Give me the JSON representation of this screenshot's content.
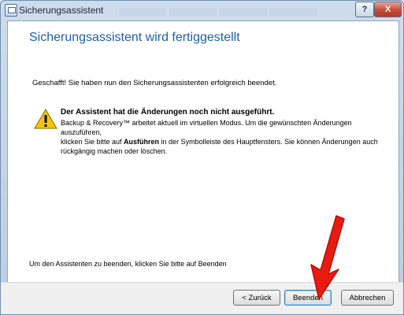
{
  "window": {
    "title": "Sicherungsassistent"
  },
  "wizard": {
    "page_title": "Sicherungsassistent wird fertiggestellt",
    "success_text": "Geschafft! Sie haben nun den Sicherungsassistenten erfolgreich beendet.",
    "warning_title": "Der Assistent hat die Änderungen noch nicht ausgeführt.",
    "warning_line1": "Backup & Recovery™ arbeitet aktuell im virtuellen Modus. Um die gewünschten Änderungen auszuführen,",
    "warning_line2_a": "klicken Sie bitte auf ",
    "warning_line2_bold": "Ausführen",
    "warning_line2_b": " in der Symbolleiste des Hauptfensters. Sie können Änderungen auch",
    "warning_line3": "rückgängig machen oder löschen.",
    "footer_text": "Um den Assistenten zu beenden, klicken Sie bitte auf Beenden"
  },
  "buttons": {
    "back": "< Zurück",
    "finish": "Beenden",
    "cancel": "Abbrechen",
    "help": "?",
    "close": "X"
  },
  "icons": {
    "app": "wizard-app-icon",
    "warning": "warning-icon",
    "annotation": "red-arrow-annotation"
  },
  "colors": {
    "title_blue": "#1f5fa8",
    "arrow_red": "#e81b10",
    "warning_yellow": "#f5c400"
  }
}
